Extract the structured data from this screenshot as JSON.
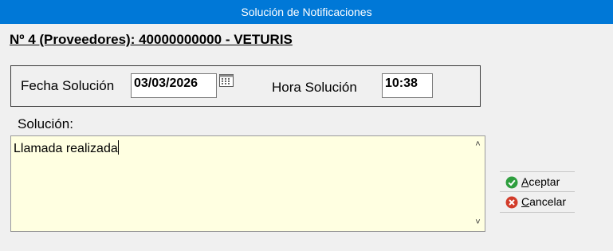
{
  "window": {
    "title": "Solución de Notificaciones"
  },
  "header": {
    "text": "Nº 4 (Proveedores): 40000000000 - VETURIS"
  },
  "date": {
    "label": "Fecha Solución",
    "value": "03/03/2026"
  },
  "time": {
    "label": "Hora Solución",
    "value": "10:38"
  },
  "solution": {
    "label": "Solución:",
    "value": "Llamada realizada"
  },
  "buttons": {
    "accept": {
      "first": "A",
      "rest": "ceptar",
      "icon": "check-circle-icon"
    },
    "cancel": {
      "first": "C",
      "rest": "ancelar",
      "icon": "x-circle-icon"
    }
  },
  "colors": {
    "titlebar": "#0078d7",
    "textarea_bg": "#ffffe1",
    "accept_icon": "#2e9e3e",
    "cancel_icon": "#d23c2a"
  }
}
